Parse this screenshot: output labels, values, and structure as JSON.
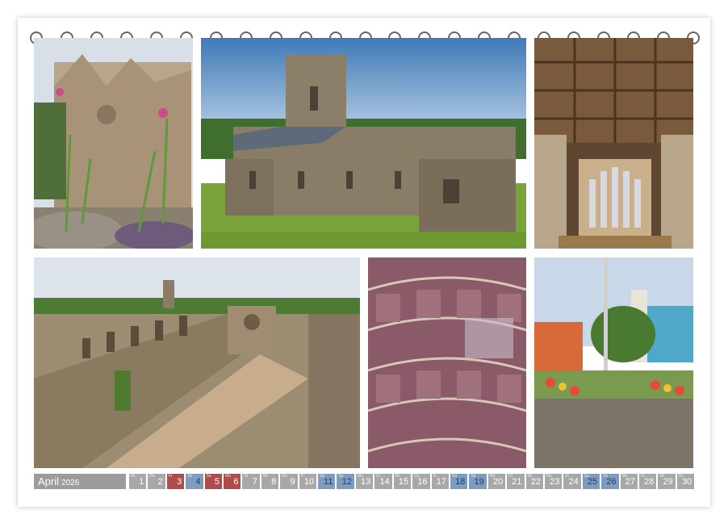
{
  "calendar": {
    "month": "April",
    "year": "2026",
    "days": [
      {
        "n": "1",
        "wd": "Mi",
        "type": "day"
      },
      {
        "n": "2",
        "wd": "Do",
        "type": "day"
      },
      {
        "n": "3",
        "wd": "Fr",
        "type": "hol"
      },
      {
        "n": "4",
        "wd": "Sa",
        "type": "sat"
      },
      {
        "n": "5",
        "wd": "So",
        "type": "sun"
      },
      {
        "n": "6",
        "wd": "Mo",
        "type": "hol"
      },
      {
        "n": "7",
        "wd": "Di",
        "type": "day"
      },
      {
        "n": "8",
        "wd": "Mi",
        "type": "day"
      },
      {
        "n": "9",
        "wd": "Do",
        "type": "day"
      },
      {
        "n": "10",
        "wd": "Fr",
        "type": "day"
      },
      {
        "n": "11",
        "wd": "Sa",
        "type": "sat"
      },
      {
        "n": "12",
        "wd": "So",
        "type": "sat"
      },
      {
        "n": "13",
        "wd": "Mo",
        "type": "day"
      },
      {
        "n": "14",
        "wd": "Di",
        "type": "day"
      },
      {
        "n": "15",
        "wd": "Mi",
        "type": "day"
      },
      {
        "n": "16",
        "wd": "Do",
        "type": "day"
      },
      {
        "n": "17",
        "wd": "Fr",
        "type": "day"
      },
      {
        "n": "18",
        "wd": "Sa",
        "type": "sat"
      },
      {
        "n": "19",
        "wd": "So",
        "type": "sat"
      },
      {
        "n": "20",
        "wd": "Mo",
        "type": "day"
      },
      {
        "n": "21",
        "wd": "Di",
        "type": "day"
      },
      {
        "n": "22",
        "wd": "Mi",
        "type": "day"
      },
      {
        "n": "23",
        "wd": "Do",
        "type": "day"
      },
      {
        "n": "24",
        "wd": "Fr",
        "type": "day"
      },
      {
        "n": "25",
        "wd": "Sa",
        "type": "sat"
      },
      {
        "n": "26",
        "wd": "So",
        "type": "sat"
      },
      {
        "n": "27",
        "wd": "Mo",
        "type": "day"
      },
      {
        "n": "28",
        "wd": "Di",
        "type": "day"
      },
      {
        "n": "29",
        "wd": "Mi",
        "type": "day"
      },
      {
        "n": "30",
        "wd": "Do",
        "type": "day"
      }
    ]
  },
  "colors": {
    "day": "#a8a8a8",
    "saturday_sunday": "#7d9cc0",
    "holiday": "#b14a4a",
    "month_label": "#9c9c9c"
  }
}
